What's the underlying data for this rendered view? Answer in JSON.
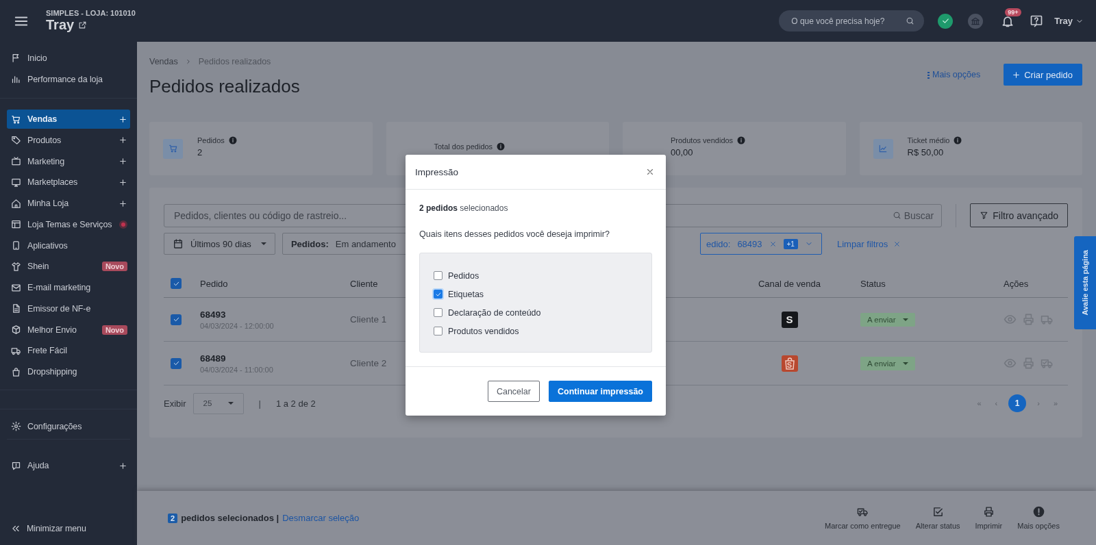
{
  "topbar": {
    "store_line": "SIMPLES - LOJA: 101010",
    "brand": "Tray",
    "search": {
      "placeholder": "O que você precisa hoje?"
    },
    "notifications_badge": "99+",
    "user": "Tray"
  },
  "sidebar": {
    "groups": [
      {
        "items": [
          {
            "label": "Inicio",
            "selected": false,
            "expandable": false,
            "alert": false
          },
          {
            "label": "Performance da loja",
            "selected": false,
            "expandable": false,
            "alert": false
          }
        ]
      },
      {
        "items": [
          {
            "label": "Vendas",
            "selected": true,
            "expandable": true,
            "alert": false
          },
          {
            "label": "Produtos",
            "selected": false,
            "expandable": true,
            "alert": false
          },
          {
            "label": "Marketing",
            "selected": false,
            "expandable": true,
            "alert": false
          },
          {
            "label": "Marketplaces",
            "selected": false,
            "expandable": true,
            "alert": false
          },
          {
            "label": "Minha Loja",
            "selected": false,
            "expandable": true,
            "alert": false
          },
          {
            "label": "Loja Temas e Serviços",
            "selected": false,
            "expandable": false,
            "alert": true
          },
          {
            "label": "Aplicativos",
            "selected": false,
            "expandable": false,
            "alert": false
          },
          {
            "label": "Shein",
            "selected": false,
            "expandable": false,
            "alert": false,
            "badge": "Novo"
          },
          {
            "label": "E-mail marketing",
            "selected": false,
            "expandable": false,
            "alert": false
          },
          {
            "label": "Emissor de NF-e",
            "selected": false,
            "expandable": false,
            "alert": false
          },
          {
            "label": "Melhor Envio",
            "selected": false,
            "expandable": false,
            "alert": false,
            "badge": "Novo"
          },
          {
            "label": "Frete Fácil",
            "selected": false,
            "expandable": false,
            "alert": false
          },
          {
            "label": "Dropshipping",
            "selected": false,
            "expandable": false,
            "alert": false
          }
        ]
      },
      {
        "items": [
          {
            "label": "Configurações",
            "selected": false,
            "expandable": false,
            "alert": false
          }
        ]
      },
      {
        "items": [
          {
            "label": "Ajuda",
            "selected": false,
            "expandable": true,
            "alert": false
          }
        ]
      }
    ],
    "minimize": "Minimizar menu"
  },
  "breadcrumb": [
    "Vendas",
    "Pedidos realizados"
  ],
  "title": "Pedidos realizados",
  "header_actions": {
    "more_options": "Mais opções",
    "create_button": "Criar pedido"
  },
  "stats": [
    {
      "label": "Pedidos",
      "value": "2"
    },
    {
      "label": "Total dos pedidos"
    },
    {
      "label": "Produtos vendidos",
      "value": "00,00"
    },
    {
      "label": "Ticket médio",
      "value": "R$ 50,00"
    }
  ],
  "filters": {
    "search": {
      "placeholder": "Pedidos, clientes ou código de rastreio..."
    },
    "search_button": "Buscar",
    "advanced_filter": "Filtro avançado",
    "dropdowns": [
      {
        "label": "Últimos 90 dias"
      },
      {
        "label": "Pedidos:",
        "value": "Em andamento"
      }
    ],
    "chip": {
      "label": "edido:",
      "value": "68493",
      "extra": "+1"
    },
    "clear_filters": "Limpar filtros"
  },
  "table": {
    "header_checked": true,
    "columns": [
      "Pedido",
      "Cliente",
      "Canal de venda",
      "Status",
      "Ações"
    ],
    "rows": [
      {
        "selected": true,
        "number": "68493",
        "date": "04/03/2024 - 12:00:00",
        "client": "Cliente 1",
        "channel": {
          "kind": "square",
          "mark": "S"
        },
        "status": "A enviar"
      },
      {
        "selected": true,
        "number": "68489",
        "date": "04/03/2024 - 11:00:00",
        "client": "Cliente 2",
        "channel": {
          "kind": "bag",
          "mark": "S"
        },
        "status": "A enviar"
      }
    ]
  },
  "pagination": {
    "show_label": "Exibir",
    "page_size": "25",
    "separator": "|",
    "range": "1 a 2 de 2",
    "first": "«",
    "prev": "‹",
    "pages": [
      {
        "label": "1",
        "selected": true
      }
    ],
    "next": "›",
    "last": "»"
  },
  "selection_bar": {
    "count": "2",
    "text": "pedidos selecionados |",
    "link": "Desmarcar seleção",
    "actions": [
      "Marcar como entregue",
      "Alterar status",
      "Imprimir",
      "Mais opções"
    ]
  },
  "modal": {
    "title": "Impressão",
    "summary": "**2 pedidos** selecionados",
    "question": "Quais itens desses pedidos você deseja imprimir?",
    "options": [
      {
        "label": "Pedidos",
        "checked": false
      },
      {
        "label": "Etiquetas",
        "checked": true
      },
      {
        "label": "Declaração de conteúdo",
        "checked": false
      },
      {
        "label": "Produtos vendidos",
        "checked": false
      }
    ],
    "cancel": "Cancelar",
    "confirm": "Continuar impressão"
  },
  "feedback_tab": "Avalie esta página"
}
